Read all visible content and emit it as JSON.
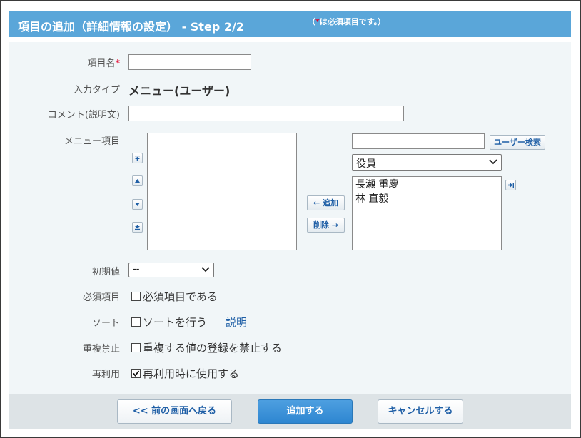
{
  "header": {
    "title": "項目の追加（詳細情報の設定） - Step 2/2",
    "note_open": "（",
    "note_mark": "*",
    "note_text": "は必須項目です。）"
  },
  "form": {
    "item_name": {
      "label": "項目名",
      "required_mark": "*",
      "value": ""
    },
    "input_type": {
      "label": "入力タイプ",
      "value": "メニュー(ユーザー)"
    },
    "comment": {
      "label": "コメント(説明文)",
      "value": ""
    },
    "menu_items": {
      "label": "メニュー項目",
      "selected_items": [],
      "add_label": "← 追加",
      "delete_label": "削除 →",
      "search_value": "",
      "search_button": "ユーザー検索",
      "group_select": "役員",
      "candidates": [
        "長瀬 重慶",
        "林 直毅"
      ]
    },
    "initial_value": {
      "label": "初期値",
      "value": "--"
    },
    "required": {
      "label": "必須項目",
      "option": "必須項目である",
      "checked": false
    },
    "sort": {
      "label": "ソート",
      "option": "ソートを行う",
      "checked": false,
      "help_link": "説明"
    },
    "no_duplicate": {
      "label": "重複禁止",
      "option": "重複する値の登録を禁止する",
      "checked": false
    },
    "reuse": {
      "label": "再利用",
      "option": "再利用時に使用する",
      "checked": true
    }
  },
  "footer": {
    "back_label": "<< 前の画面へ戻る",
    "add_label": "追加する",
    "cancel_label": "キャンセルする"
  },
  "colors": {
    "header_bg": "#5aa6d9",
    "panel_bg": "#f1f6f8",
    "footer_bg": "#dde3e6",
    "link": "#1f5fa6",
    "required_mark": "#e4002b",
    "primary_button": "#2e86d1"
  },
  "icons": {
    "move_top": "arrow-to-top-icon",
    "move_up": "triangle-up-icon",
    "move_down": "triangle-down-icon",
    "move_bottom": "arrow-to-bottom-icon",
    "add_all": "arrow-to-right-icon",
    "dropdown": "chevron-down-icon",
    "checkmark": "checkmark-icon"
  }
}
